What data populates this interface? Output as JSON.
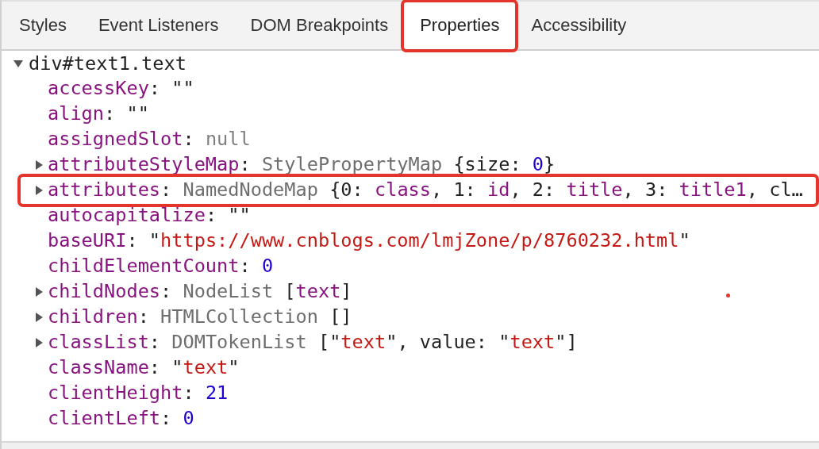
{
  "tabs": [
    {
      "label": "Styles",
      "selected": false,
      "highlighted": false
    },
    {
      "label": "Event Listeners",
      "selected": false,
      "highlighted": false
    },
    {
      "label": "DOM Breakpoints",
      "selected": false,
      "highlighted": false
    },
    {
      "label": "Properties",
      "selected": true,
      "highlighted": true
    },
    {
      "label": "Accessibility",
      "selected": false,
      "highlighted": false
    }
  ],
  "object": {
    "label": "div#text1.text",
    "expanded": true,
    "properties": [
      {
        "name": "accessKey",
        "expandable": false,
        "highlighted": false,
        "tokens": [
          {
            "kind": "plain",
            "text": ": \"\""
          }
        ]
      },
      {
        "name": "align",
        "expandable": false,
        "highlighted": false,
        "tokens": [
          {
            "kind": "plain",
            "text": ": \"\""
          }
        ]
      },
      {
        "name": "assignedSlot",
        "expandable": false,
        "highlighted": false,
        "tokens": [
          {
            "kind": "plain",
            "text": ": "
          },
          {
            "kind": "null",
            "text": "null"
          }
        ]
      },
      {
        "name": "attributeStyleMap",
        "expandable": true,
        "highlighted": false,
        "tokens": [
          {
            "kind": "plain",
            "text": ": "
          },
          {
            "kind": "type",
            "text": "StylePropertyMap"
          },
          {
            "kind": "plain",
            "text": " {size: "
          },
          {
            "kind": "number",
            "text": "0"
          },
          {
            "kind": "plain",
            "text": "}"
          }
        ]
      },
      {
        "name": "attributes",
        "expandable": true,
        "highlighted": true,
        "tokens": [
          {
            "kind": "plain",
            "text": ": "
          },
          {
            "kind": "type",
            "text": "NamedNodeMap"
          },
          {
            "kind": "plain",
            "text": " {0: "
          },
          {
            "kind": "key",
            "text": "class"
          },
          {
            "kind": "plain",
            "text": ", 1: "
          },
          {
            "kind": "key",
            "text": "id"
          },
          {
            "kind": "plain",
            "text": ", 2: "
          },
          {
            "kind": "key",
            "text": "title"
          },
          {
            "kind": "plain",
            "text": ", 3: "
          },
          {
            "kind": "key",
            "text": "title1"
          },
          {
            "kind": "plain",
            "text": ", cl…"
          }
        ]
      },
      {
        "name": "autocapitalize",
        "expandable": false,
        "highlighted": false,
        "tokens": [
          {
            "kind": "plain",
            "text": ": \"\""
          }
        ]
      },
      {
        "name": "baseURI",
        "expandable": false,
        "highlighted": false,
        "tokens": [
          {
            "kind": "plain",
            "text": ": \""
          },
          {
            "kind": "string",
            "text": "https://www.cnblogs.com/lmjZone/p/8760232.html"
          },
          {
            "kind": "plain",
            "text": "\""
          }
        ]
      },
      {
        "name": "childElementCount",
        "expandable": false,
        "highlighted": false,
        "tokens": [
          {
            "kind": "plain",
            "text": ": "
          },
          {
            "kind": "number",
            "text": "0"
          }
        ]
      },
      {
        "name": "childNodes",
        "expandable": true,
        "highlighted": false,
        "tokens": [
          {
            "kind": "plain",
            "text": ": "
          },
          {
            "kind": "type",
            "text": "NodeList"
          },
          {
            "kind": "plain",
            "text": " ["
          },
          {
            "kind": "key",
            "text": "text"
          },
          {
            "kind": "plain",
            "text": "]"
          }
        ]
      },
      {
        "name": "children",
        "expandable": true,
        "highlighted": false,
        "tokens": [
          {
            "kind": "plain",
            "text": ": "
          },
          {
            "kind": "type",
            "text": "HTMLCollection"
          },
          {
            "kind": "plain",
            "text": " []"
          }
        ]
      },
      {
        "name": "classList",
        "expandable": true,
        "highlighted": false,
        "tokens": [
          {
            "kind": "plain",
            "text": ": "
          },
          {
            "kind": "type",
            "text": "DOMTokenList"
          },
          {
            "kind": "plain",
            "text": " [\""
          },
          {
            "kind": "string",
            "text": "text"
          },
          {
            "kind": "plain",
            "text": "\", value: \""
          },
          {
            "kind": "string",
            "text": "text"
          },
          {
            "kind": "plain",
            "text": "\"]"
          }
        ]
      },
      {
        "name": "className",
        "expandable": false,
        "highlighted": false,
        "tokens": [
          {
            "kind": "plain",
            "text": ": \""
          },
          {
            "kind": "string",
            "text": "text"
          },
          {
            "kind": "plain",
            "text": "\""
          }
        ]
      },
      {
        "name": "clientHeight",
        "expandable": false,
        "highlighted": false,
        "tokens": [
          {
            "kind": "plain",
            "text": ": "
          },
          {
            "kind": "number",
            "text": "21"
          }
        ]
      },
      {
        "name": "clientLeft",
        "expandable": false,
        "highlighted": false,
        "tokens": [
          {
            "kind": "plain",
            "text": ": "
          },
          {
            "kind": "number",
            "text": "0"
          }
        ]
      }
    ]
  }
}
